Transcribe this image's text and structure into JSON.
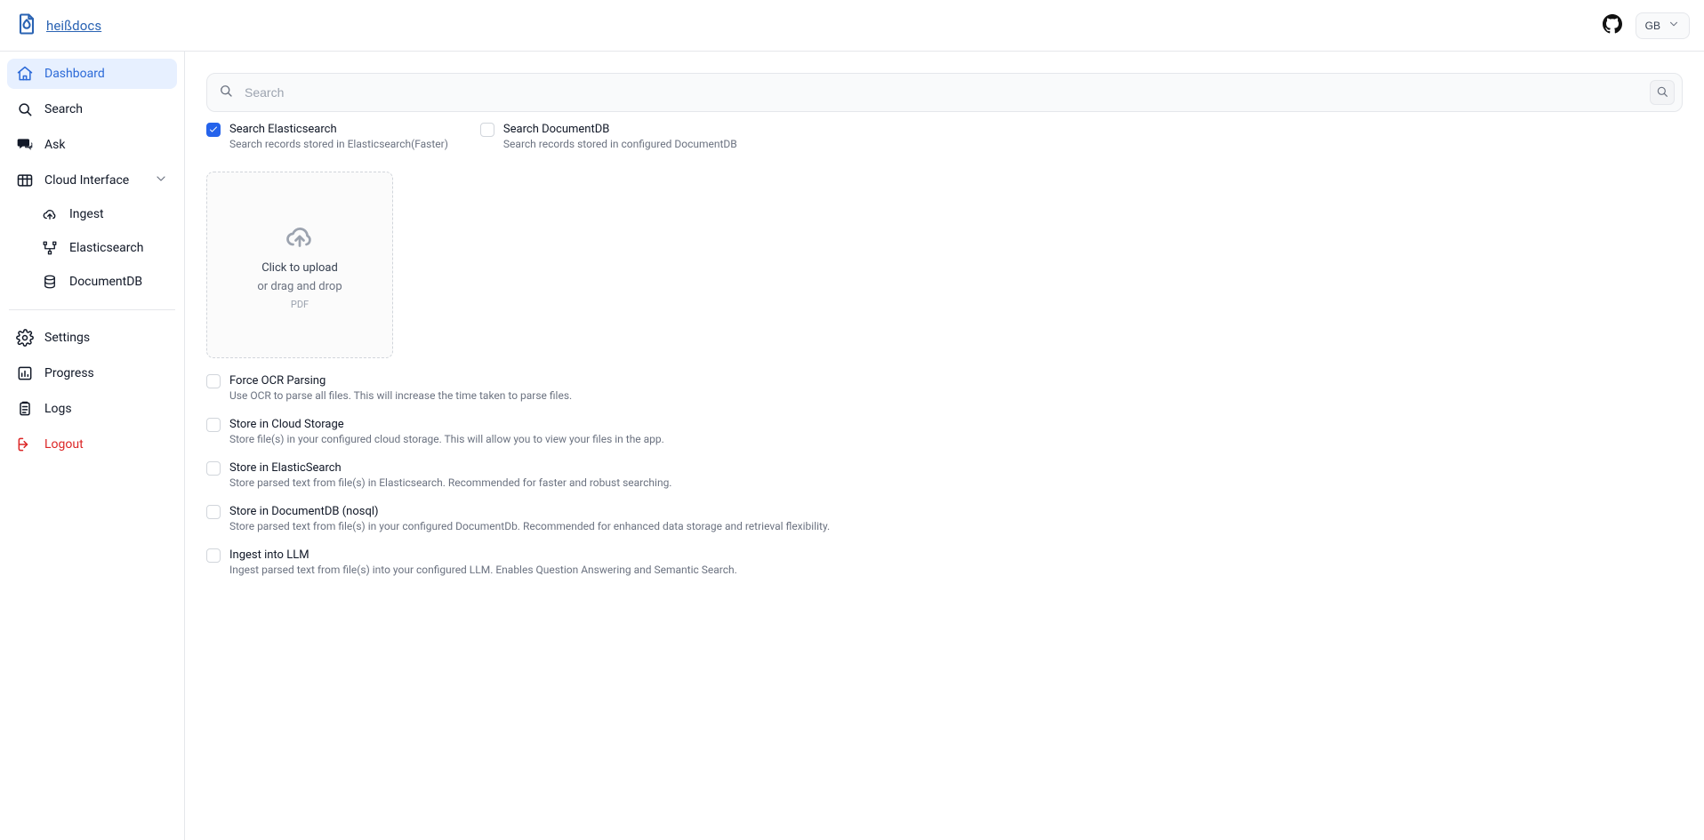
{
  "brand": {
    "name": "heißdocs"
  },
  "header": {
    "locale_selected": "GB"
  },
  "sidebar": {
    "items": [
      {
        "key": "dashboard",
        "label": "Dashboard",
        "active": true
      },
      {
        "key": "search",
        "label": "Search"
      },
      {
        "key": "ask",
        "label": "Ask"
      },
      {
        "key": "cloud",
        "label": "Cloud Interface",
        "expandable": true,
        "expanded": true,
        "children": [
          {
            "key": "ingest",
            "label": "Ingest"
          },
          {
            "key": "elasticsearch",
            "label": "Elasticsearch"
          },
          {
            "key": "documentdb",
            "label": "DocumentDB"
          }
        ]
      }
    ],
    "settings": {
      "label": "Settings"
    },
    "progress": {
      "label": "Progress"
    },
    "logs": {
      "label": "Logs"
    },
    "logout": {
      "label": "Logout"
    }
  },
  "search": {
    "placeholder": "Search",
    "value": ""
  },
  "filters": {
    "es": {
      "title": "Search Elasticsearch",
      "desc": "Search records stored in Elasticsearch(Faster)",
      "checked": true
    },
    "docdb": {
      "title": "Search DocumentDB",
      "desc": "Search records stored in configured DocumentDB",
      "checked": false
    }
  },
  "dropzone": {
    "primary": "Click to upload",
    "secondary": "or drag and drop",
    "hint": "PDF"
  },
  "options": {
    "force_ocr": {
      "title": "Force OCR Parsing",
      "desc": "Use OCR to parse all files. This will increase the time taken to parse files."
    },
    "store_cloud": {
      "title": "Store in Cloud Storage",
      "desc": "Store file(s) in your configured cloud storage. This will allow you to view your files in the app."
    },
    "store_es": {
      "title": "Store in ElasticSearch",
      "desc": "Store parsed text from file(s) in Elasticsearch. Recommended for faster and robust searching."
    },
    "store_docdb": {
      "title": "Store in DocumentDB (nosql)",
      "desc": "Store parsed text from file(s) in your configured DocumentDb. Recommended for enhanced data storage and retrieval flexibility."
    },
    "ingest_llm": {
      "title": "Ingest into LLM",
      "desc": "Ingest parsed text from file(s) into your configured LLM. Enables Question Answering and Semantic Search."
    }
  }
}
